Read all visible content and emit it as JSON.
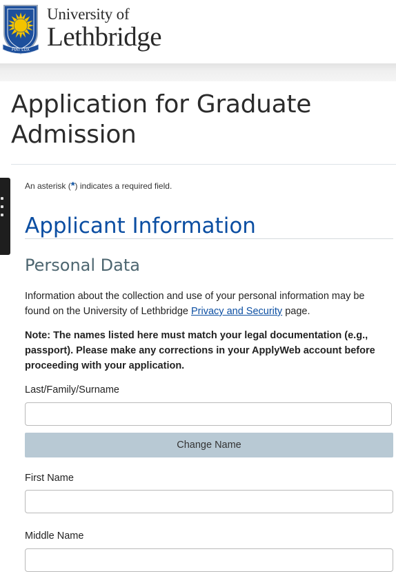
{
  "header": {
    "logo_line1": "University of",
    "logo_line2": "Lethbridge",
    "crest_motto": "FIAT LUX"
  },
  "page": {
    "title": "Application for Graduate Admission",
    "required_note_prefix": "An asterisk (",
    "required_note_asterisk": "*",
    "required_note_suffix": ") indicates a required field."
  },
  "section": {
    "heading": "Applicant Information",
    "subheading": "Personal Data",
    "info_text_before_link": "Information about the collection and use of your personal information may be found on the University of Lethbridge ",
    "info_link": "Privacy and Security",
    "info_text_after_link": " page.",
    "note": "Note: The names listed here must match your legal documentation (e.g., passport). Please make any corrections in your ApplyWeb account before proceeding with your application."
  },
  "form": {
    "last_name_label": "Last/Family/Surname",
    "last_name_value": "",
    "change_name_button": "Change Name",
    "first_name_label": "First Name",
    "first_name_value": "",
    "middle_name_label": "Middle Name",
    "middle_name_value": ""
  },
  "colors": {
    "heading_blue": "#0b4ea2",
    "subheading_gray": "#4d6670",
    "button_bg": "#b8c9d4",
    "crest_blue": "#1d4f9c",
    "crest_gold": "#f2c300"
  }
}
